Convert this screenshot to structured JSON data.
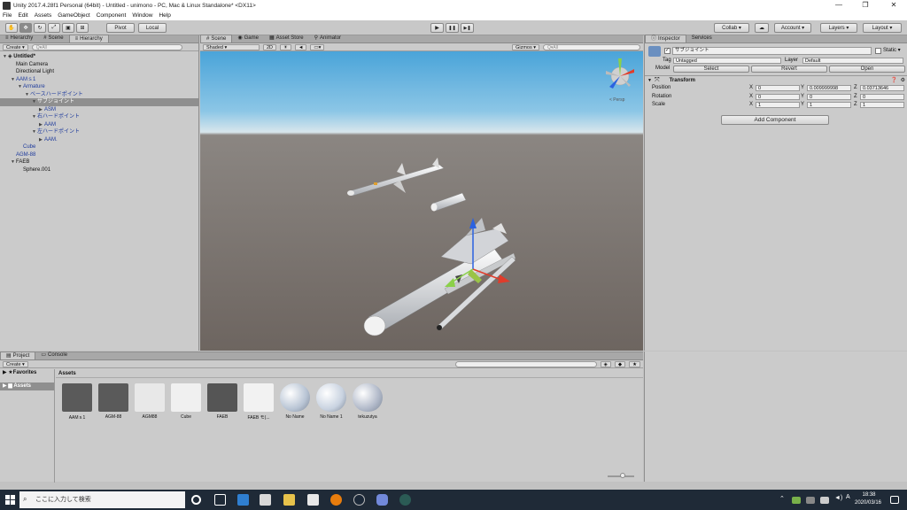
{
  "window": {
    "title": "Unity 2017.4.28f1 Personal (64bit) - Untitled - unimono - PC, Mac & Linux Standalone* <DX11>",
    "minimize": "—",
    "maximize": "❐",
    "close": "✕"
  },
  "menu": [
    "File",
    "Edit",
    "Assets",
    "GameObject",
    "Component",
    "Window",
    "Help"
  ],
  "toolbar": {
    "pivot": "Pivot",
    "local": "Local",
    "play": "▶",
    "pause": "❚❚",
    "step": "▶❚",
    "collab": "Collab ▾",
    "account": "Account ▾",
    "layers": "Layers ▾",
    "layout": "Layout ▾"
  },
  "hierarchy": {
    "tabs": [
      "Hierarchy",
      "Scene",
      "Hierarchy"
    ],
    "create": "Create ▾",
    "search_placeholder": "Q▾All",
    "scene_name": "Untitled*",
    "items": [
      {
        "label": "Main Camera",
        "indent": 1,
        "arrow": "",
        "color": "black",
        "selected": false
      },
      {
        "label": "Directional Light",
        "indent": 1,
        "arrow": "",
        "color": "black",
        "selected": false
      },
      {
        "label": "AAMｓ1",
        "indent": 1,
        "arrow": "▼",
        "color": "blue",
        "selected": false
      },
      {
        "label": "Armature",
        "indent": 2,
        "arrow": "▼",
        "color": "blue",
        "selected": false
      },
      {
        "label": "ベースハードポイント",
        "indent": 3,
        "arrow": "▼",
        "color": "blue",
        "selected": false
      },
      {
        "label": "サブジョイント",
        "indent": 4,
        "arrow": "▼",
        "color": "blue",
        "selected": true
      },
      {
        "label": "ASM",
        "indent": 5,
        "arrow": "▶",
        "color": "blue",
        "selected": false
      },
      {
        "label": "右ハードポイント",
        "indent": 4,
        "arrow": "▼",
        "color": "blue",
        "selected": false
      },
      {
        "label": "AAM",
        "indent": 5,
        "arrow": "▶",
        "color": "blue",
        "selected": false
      },
      {
        "label": "左ハードポイント",
        "indent": 4,
        "arrow": "▼",
        "color": "blue",
        "selected": false
      },
      {
        "label": "AAM.",
        "indent": 5,
        "arrow": "▶",
        "color": "blue",
        "selected": false
      },
      {
        "label": "Cube",
        "indent": 2,
        "arrow": "",
        "color": "blue",
        "selected": false
      },
      {
        "label": "AGM-88",
        "indent": 1,
        "arrow": "",
        "color": "blue",
        "selected": false
      },
      {
        "label": "FAEB",
        "indent": 1,
        "arrow": "▼",
        "color": "black",
        "selected": false
      },
      {
        "label": "Sphere.001",
        "indent": 2,
        "arrow": "",
        "color": "black",
        "selected": false
      }
    ]
  },
  "scene": {
    "tabs": [
      "Scene",
      "Game",
      "Asset Store",
      "Animator"
    ],
    "shading": "Shaded ▾",
    "mode_2d": "2D",
    "gizmos": "Gizmos ▾",
    "search_placeholder": "Q▾All",
    "persp_label": "< Persp"
  },
  "inspector": {
    "tabs": [
      "Inspector",
      "Services"
    ],
    "object_name": "サブジョイント",
    "static_label": "Static ▾",
    "tag_label": "Tag",
    "tag_value": "Untagged",
    "layer_label": "Layer",
    "layer_value": "Default",
    "model_label": "Model",
    "model_buttons": [
      "Select",
      "Revert",
      "Open"
    ],
    "transform_title": "Transform",
    "rows": [
      {
        "label": "Position",
        "x": "0",
        "y": "0.009999998",
        "z": "0.03713646"
      },
      {
        "label": "Rotation",
        "x": "0",
        "y": "0",
        "z": "0"
      },
      {
        "label": "Scale",
        "x": "1",
        "y": "1",
        "z": "1"
      }
    ],
    "add_component": "Add Component"
  },
  "project": {
    "tabs": [
      "Project",
      "Console"
    ],
    "create": "Create ▾",
    "favorites": "Favorites",
    "assets_folder": "Assets",
    "breadcrumb": "Assets",
    "assets": [
      {
        "name": "AAMｓ1",
        "color": "#5a5a5a"
      },
      {
        "name": "AGM-88",
        "color": "#5a5a5a"
      },
      {
        "name": "AGM88",
        "color": "#e8e8e8"
      },
      {
        "name": "Cube",
        "color": "#f0f0f0"
      },
      {
        "name": "FAEB",
        "color": "#555555"
      },
      {
        "name": "FAEB モ(...",
        "color": "#f2f2f2"
      },
      {
        "name": "No Name",
        "color": "#b8c4d4"
      },
      {
        "name": "No Name 1",
        "color": "#c8d2e0"
      },
      {
        "name": "tekuzutya",
        "color": "#b0b8c8"
      }
    ]
  },
  "taskbar": {
    "search_placeholder": "ここに入力して検索",
    "time": "18:38",
    "date": "2020/03/16"
  }
}
